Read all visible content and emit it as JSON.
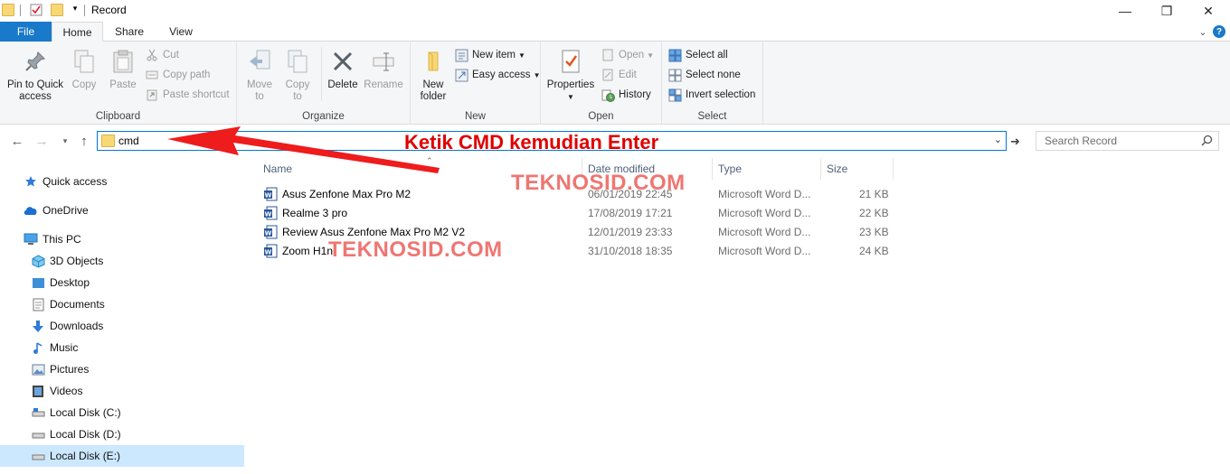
{
  "window": {
    "title": "Record",
    "minimize_glyph": "—",
    "maximize_glyph": "❐",
    "close_glyph": "✕"
  },
  "ribbon_tabs": {
    "file": "File",
    "home": "Home",
    "share": "Share",
    "view": "View",
    "collapse_glyph": "⌄",
    "help_glyph": "?"
  },
  "ribbon": {
    "clipboard": {
      "label": "Clipboard",
      "pin_line1": "Pin to Quick",
      "pin_line2": "access",
      "copy": "Copy",
      "paste": "Paste",
      "cut": "Cut",
      "copy_path": "Copy path",
      "paste_shortcut": "Paste shortcut"
    },
    "organize": {
      "label": "Organize",
      "move_line1": "Move",
      "move_line2": "to",
      "copy_line1": "Copy",
      "copy_line2": "to",
      "delete": "Delete",
      "rename": "Rename"
    },
    "new": {
      "label": "New",
      "folder_line1": "New",
      "folder_line2": "folder",
      "new_item": "New item",
      "easy_access": "Easy access"
    },
    "open": {
      "label": "Open",
      "properties": "Properties",
      "open": "Open",
      "edit": "Edit",
      "history": "History"
    },
    "select": {
      "label": "Select",
      "select_all": "Select all",
      "select_none": "Select none",
      "invert": "Invert selection"
    }
  },
  "address": {
    "value": "cmd",
    "search_placeholder": "Search Record"
  },
  "nav": {
    "items": [
      {
        "label": "Quick access",
        "icon": "star-icon"
      },
      {
        "label": "OneDrive",
        "icon": "cloud-icon"
      },
      {
        "label": "This PC",
        "icon": "monitor-icon"
      },
      {
        "label": "3D Objects",
        "icon": "cube-icon"
      },
      {
        "label": "Desktop",
        "icon": "desktop-icon"
      },
      {
        "label": "Documents",
        "icon": "document-icon"
      },
      {
        "label": "Downloads",
        "icon": "download-icon"
      },
      {
        "label": "Music",
        "icon": "music-icon"
      },
      {
        "label": "Pictures",
        "icon": "picture-icon"
      },
      {
        "label": "Videos",
        "icon": "video-icon"
      },
      {
        "label": "Local Disk (C:)",
        "icon": "drive-icon"
      },
      {
        "label": "Local Disk (D:)",
        "icon": "drive-icon"
      },
      {
        "label": "Local Disk (E:)",
        "icon": "drive-icon"
      }
    ]
  },
  "columns": {
    "name": "Name",
    "date": "Date modified",
    "type": "Type",
    "size": "Size"
  },
  "files": [
    {
      "name": "Asus Zenfone Max Pro M2",
      "date": "06/01/2019 22:45",
      "type": "Microsoft Word D...",
      "size": "21 KB"
    },
    {
      "name": "Realme 3 pro",
      "date": "17/08/2019 17:21",
      "type": "Microsoft Word D...",
      "size": "22 KB"
    },
    {
      "name": "Review Asus Zenfone Max Pro M2 V2",
      "date": "12/01/2019 23:33",
      "type": "Microsoft Word D...",
      "size": "23 KB"
    },
    {
      "name": "Zoom H1n",
      "date": "31/10/2018 18:35",
      "type": "Microsoft Word D...",
      "size": "24 KB"
    }
  ],
  "overlay": {
    "annotation": "Ketik CMD kemudian Enter",
    "watermark": "TEKNOSID.COM",
    "annotation_color": "#e00000",
    "accent_color": "#0078d7",
    "selected_color": "#cce8ff"
  }
}
